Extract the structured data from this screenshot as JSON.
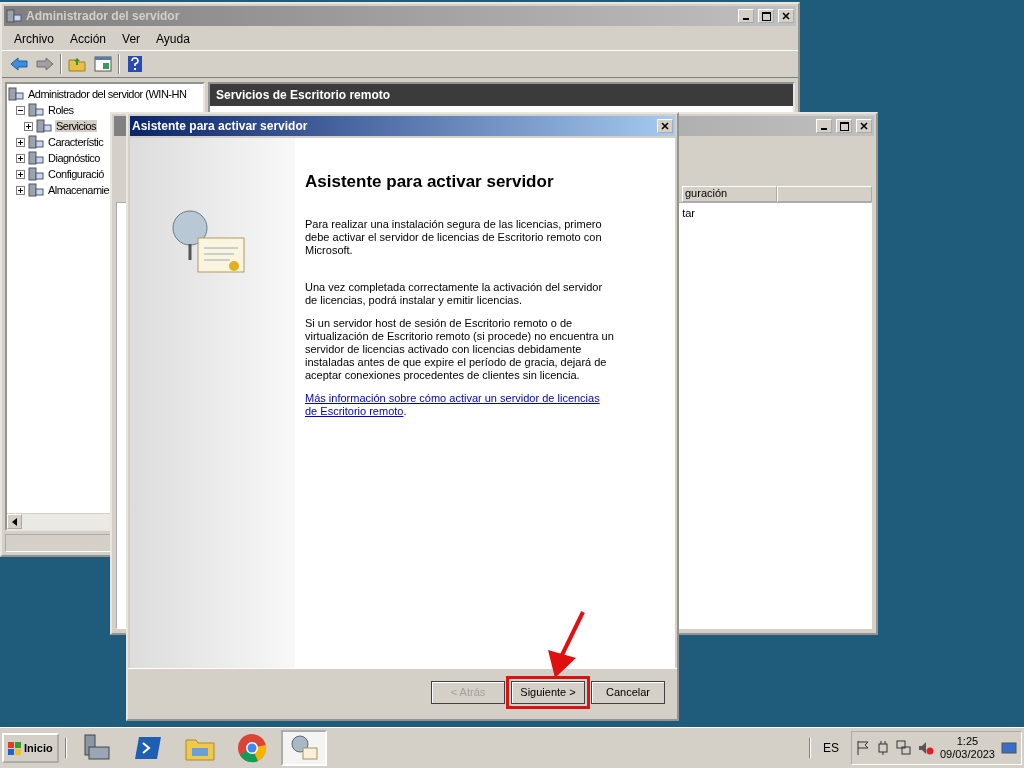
{
  "server_manager": {
    "title": "Administrador del servidor",
    "menu": [
      "Archivo",
      "Acción",
      "Ver",
      "Ayuda"
    ],
    "tree": [
      {
        "label": "Administrador del servidor (WIN-HN",
        "selected": false,
        "children": [
          {
            "label": "Roles",
            "selected": false,
            "expanded": true,
            "children": [
              {
                "label": "Servicios",
                "selected": true,
                "expanded": false
              }
            ]
          },
          {
            "label": "Característic",
            "selected": false,
            "expanded": false
          },
          {
            "label": "Diagnóstico",
            "selected": false,
            "expanded": false
          },
          {
            "label": "Configuració",
            "selected": false,
            "expanded": false
          },
          {
            "label": "Almacenamie",
            "selected": false,
            "expanded": false
          }
        ]
      }
    ],
    "pane_header": "Servicios de Escritorio remoto"
  },
  "background_window": {
    "columns": [
      "guración"
    ],
    "cell": "tar"
  },
  "wizard": {
    "title": "Asistente para activar servidor",
    "heading": "Asistente para activar servidor",
    "paragraphs": [
      "Para realizar una instalación segura de las licencias, primero debe activar el servidor de licencias de Escritorio remoto con Microsoft.",
      "Una vez completada correctamente la activación del servidor de licencias, podrá instalar y emitir licencias.",
      "Si un servidor host de sesión de Escritorio remoto o de virtualización de Escritorio remoto (si procede) no encuentra un servidor de licencias activado con licencias debidamente instaladas antes de que expire el período de gracia, dejará de aceptar conexiones procedentes de clientes sin licencia."
    ],
    "link_lines": [
      "Más información sobre cómo activar un servidor de licencias",
      "de Escritorio remoto"
    ],
    "link_tail": ".",
    "buttons": [
      {
        "label": "< Atrás",
        "disabled": true,
        "highlighted": false
      },
      {
        "label": "Siguiente >",
        "disabled": false,
        "highlighted": true
      },
      {
        "label": "Cancelar",
        "disabled": false,
        "highlighted": false
      }
    ]
  },
  "taskbar": {
    "start": "Inicio",
    "items": [
      {
        "kind": "server",
        "selected": false
      },
      {
        "kind": "shell",
        "selected": false
      },
      {
        "kind": "folder",
        "selected": false
      },
      {
        "kind": "browser",
        "selected": false
      },
      {
        "kind": "wizard",
        "selected": true
      }
    ],
    "language": "ES",
    "time": "1:25",
    "date": "09/03/2023"
  }
}
